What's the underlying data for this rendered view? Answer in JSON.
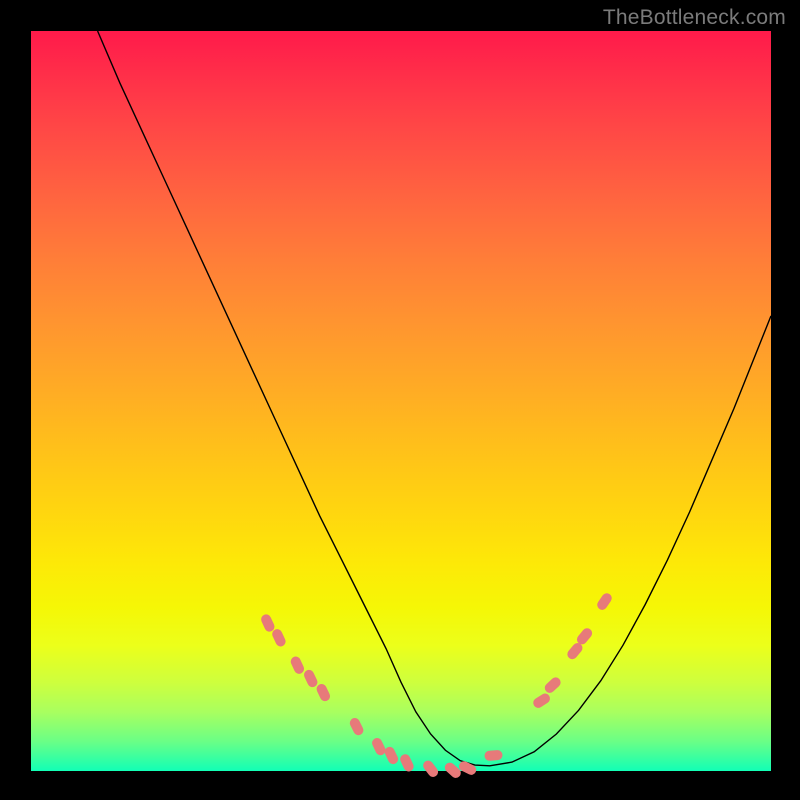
{
  "watermark": "TheBottleneck.com",
  "chart_data": {
    "type": "line",
    "title": "",
    "xlabel": "",
    "ylabel": "",
    "xlim": [
      0,
      100
    ],
    "ylim": [
      0,
      100
    ],
    "series": [
      {
        "name": "curve",
        "x": [
          9,
          12,
          15,
          18,
          21,
          24,
          27,
          30,
          33,
          36,
          39,
          42,
          45,
          48,
          50,
          52,
          54,
          56,
          58,
          60,
          62,
          65,
          68,
          71,
          74,
          77,
          80,
          83,
          86,
          89,
          92,
          95,
          98,
          100
        ],
        "y": [
          100,
          93,
          86.5,
          80,
          73.5,
          67,
          60.5,
          54,
          47.5,
          41,
          34.5,
          28.5,
          22.5,
          16.5,
          12,
          8,
          5,
          2.8,
          1.4,
          0.8,
          0.7,
          1.2,
          2.6,
          5,
          8.2,
          12.2,
          17,
          22.5,
          28.5,
          35,
          42,
          49,
          56.5,
          61.5
        ]
      }
    ],
    "markers": [
      {
        "x": 32,
        "y": 20
      },
      {
        "x": 33.5,
        "y": 18
      },
      {
        "x": 36,
        "y": 14.3
      },
      {
        "x": 37.8,
        "y": 12.5
      },
      {
        "x": 39.5,
        "y": 10.6
      },
      {
        "x": 44,
        "y": 6
      },
      {
        "x": 47,
        "y": 3.3
      },
      {
        "x": 48.7,
        "y": 2.1
      },
      {
        "x": 50.8,
        "y": 1.1
      },
      {
        "x": 54,
        "y": 0.3
      },
      {
        "x": 57,
        "y": 0.1
      },
      {
        "x": 59,
        "y": 0.4
      },
      {
        "x": 62.5,
        "y": 2.1
      },
      {
        "x": 69,
        "y": 9.5
      },
      {
        "x": 70.5,
        "y": 11.6
      },
      {
        "x": 73.5,
        "y": 16.2
      },
      {
        "x": 74.8,
        "y": 18.2
      },
      {
        "x": 77.5,
        "y": 22.9
      }
    ],
    "background_gradient": {
      "top": "#ff1a4a",
      "bottom": "#11ffb6"
    }
  }
}
